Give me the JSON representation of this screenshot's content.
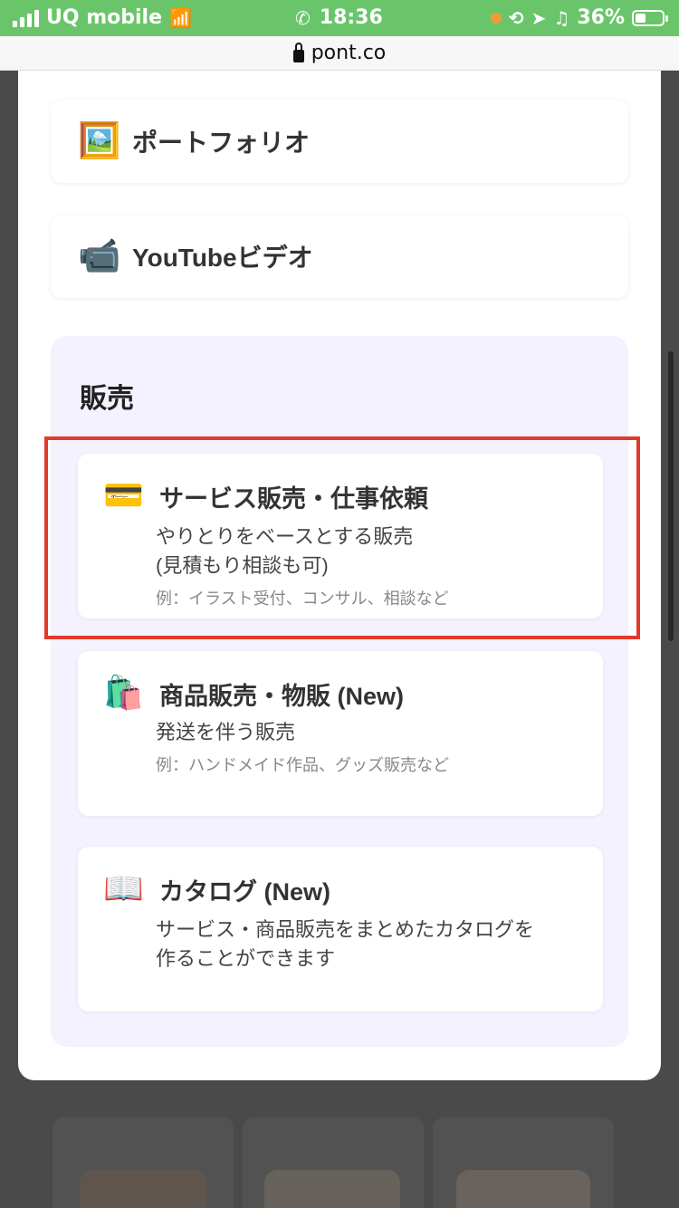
{
  "status_bar": {
    "carrier": "UQ mobile",
    "time": "18:36",
    "battery": "36%"
  },
  "url_bar": {
    "domain": "pont.co"
  },
  "options": [
    {
      "icon": "framed-picture-icon",
      "glyph": "🖼️",
      "label": "ポートフォリオ"
    },
    {
      "icon": "video-camera-icon",
      "glyph": "📹",
      "label": "YouTubeビデオ"
    }
  ],
  "sales": {
    "title": "販売",
    "items": [
      {
        "icon": "credit-card-icon",
        "glyph": "💳",
        "title": "サービス販売・仕事依頼",
        "desc_lines": [
          "やりとりをベースとする販売",
          "(見積もり相談も可)"
        ],
        "example": "例：イラスト受付、コンサル、相談など"
      },
      {
        "icon": "shopping-bags-icon",
        "glyph": "🛍️",
        "title": "商品販売・物販 (New)",
        "desc_lines": [
          "発送を伴う販売"
        ],
        "example": "例：ハンドメイド作品、グッズ販売など"
      },
      {
        "icon": "open-book-icon",
        "glyph": "📖",
        "title": "カタログ (New)",
        "desc_lines": [
          "サービス・商品販売をまとめたカタログを",
          "作ることができます"
        ],
        "example": ""
      }
    ]
  },
  "colors": {
    "status_bar": "#6ac56a",
    "highlight": "#e03a2f",
    "sales_panel": "#f4f2ff"
  }
}
